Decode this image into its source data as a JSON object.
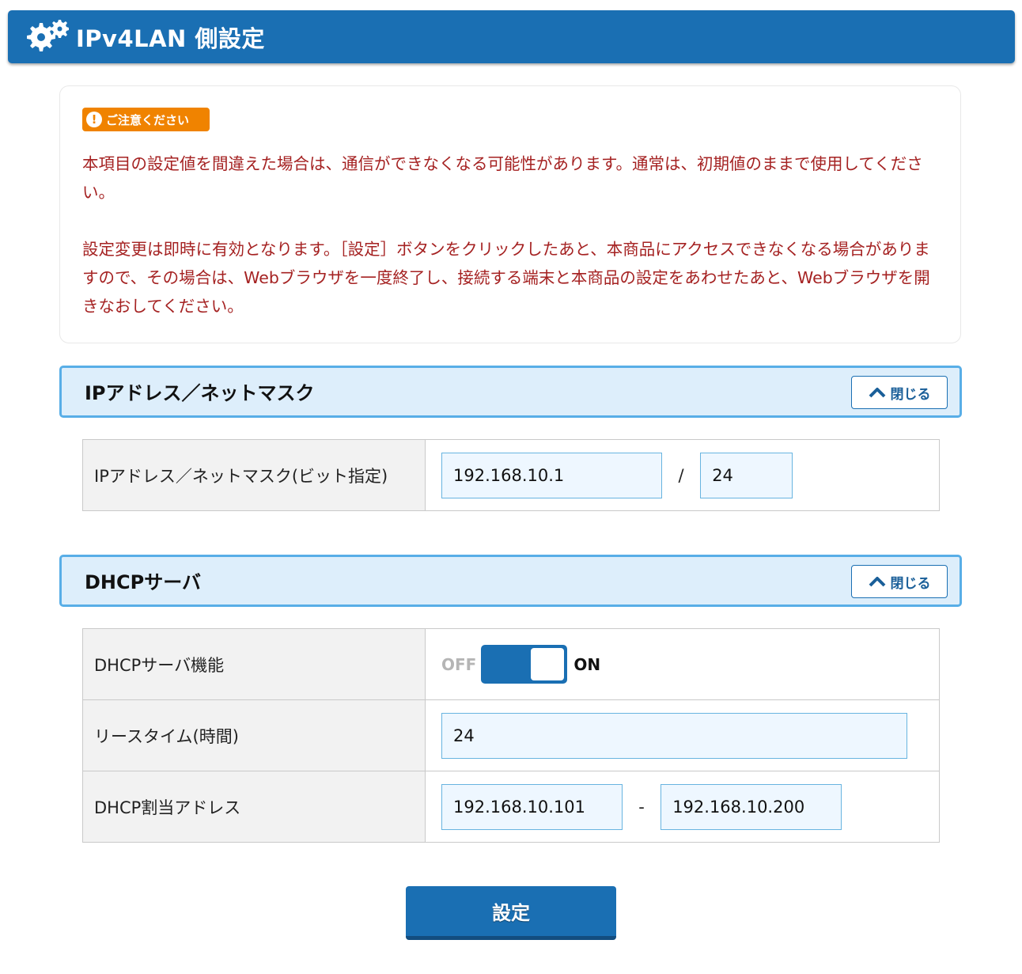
{
  "header": {
    "title": "IPv4LAN 側設定",
    "icon": "gears-icon"
  },
  "notice": {
    "badge": "ご注意ください",
    "paragraph1": "本項目の設定値を間違えた場合は、通信ができなくなる可能性があります。通常は、初期値のままで使用してください。",
    "paragraph2": "設定変更は即時に有効となります。［設定］ボタンをクリックしたあと、本商品にアクセスできなくなる場合がありますので、その場合は、Webブラウザを一度終了し、接続する端末と本商品の設定をあわせたあと、Webブラウザを開きなおしてください。"
  },
  "ip_section": {
    "title": "IPアドレス／ネットマスク",
    "close_label": "閉じる",
    "row_label": "IPアドレス／ネットマスク(ビット指定)",
    "ip_value": "192.168.10.1",
    "separator": "/",
    "mask_value": "24"
  },
  "dhcp_section": {
    "title": "DHCPサーバ",
    "close_label": "閉じる",
    "function_label": "DHCPサーバ機能",
    "toggle_off": "OFF",
    "toggle_on": "ON",
    "toggle_state": "ON",
    "lease_label": "リースタイム(時間)",
    "lease_value": "24",
    "range_label": "DHCP割当アドレス",
    "range_start": "192.168.10.101",
    "range_separator": "-",
    "range_end": "192.168.10.200"
  },
  "submit_label": "設定",
  "colors": {
    "primary": "#1a6fb3",
    "notice_text": "#a52222",
    "badge": "#f08300",
    "section_bg": "#ddeefb",
    "section_border": "#58aee7"
  }
}
